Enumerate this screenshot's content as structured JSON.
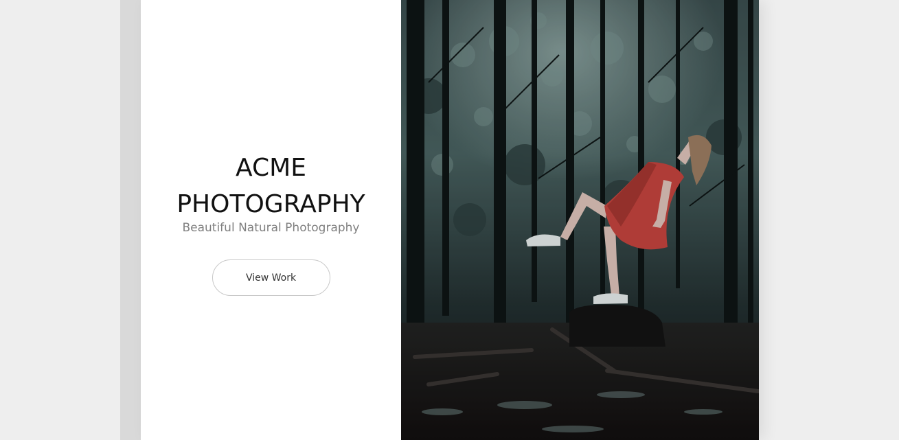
{
  "hero": {
    "title_line1": "ACME",
    "title_line2": "PHOTOGRAPHY",
    "subtitle": "Beautiful Natural Photography",
    "cta_label": "View Work"
  },
  "photo": {
    "subject": "woman in red dress leaning back in a dark forest",
    "colors": {
      "canopy": "#5f7a78",
      "trees": "#10181a",
      "dress": "#c8453f",
      "ground": "#1c1a1a"
    }
  }
}
